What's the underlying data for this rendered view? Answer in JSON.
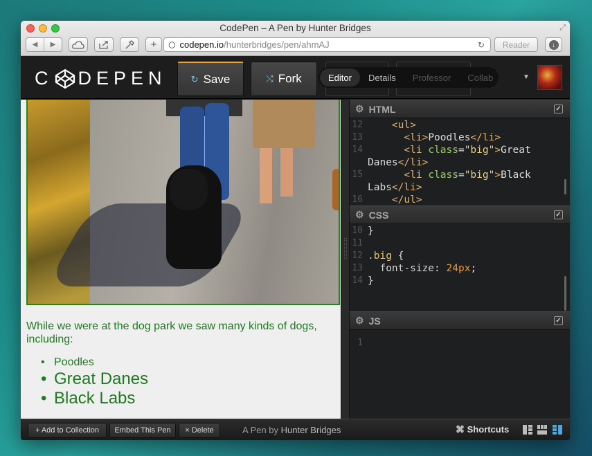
{
  "window": {
    "title": "CodePen – A Pen by Hunter Bridges"
  },
  "toolbar": {
    "url_host": "codepen.io",
    "url_path": "/hunterbridges/pen/ahmAJ",
    "reader_label": "Reader",
    "plus_label": "+"
  },
  "header": {
    "logo_text_left": "C",
    "logo_text_right": "DEPEN",
    "save_label": "Save",
    "fork_label": "Fork",
    "view_tabs": [
      "Editor",
      "Details",
      "Professor",
      "Collab"
    ],
    "active_view": "Editor"
  },
  "preview": {
    "intro": "While we were at the dog park we saw many kinds of dogs, including:",
    "items": [
      {
        "label": "Poodles",
        "size": "normal"
      },
      {
        "label": "Great Danes",
        "size": "big"
      },
      {
        "label": "Black Labs",
        "size": "big"
      }
    ]
  },
  "editors": {
    "html": {
      "title": "HTML",
      "lines": [
        {
          "n": "12",
          "indent": "    ",
          "parts": [
            [
              "tag",
              "<ul>"
            ]
          ]
        },
        {
          "n": "13",
          "indent": "      ",
          "parts": [
            [
              "tag",
              "<li>"
            ],
            [
              "text",
              "Poodles"
            ],
            [
              "tag",
              "</li>"
            ]
          ]
        },
        {
          "n": "14",
          "indent": "      ",
          "parts": [
            [
              "tag",
              "<li "
            ],
            [
              "attr",
              "class"
            ],
            [
              "text",
              "="
            ],
            [
              "str",
              "\"big\""
            ],
            [
              "tag",
              ">"
            ],
            [
              "text",
              "Great"
            ]
          ]
        },
        {
          "n": "",
          "indent": "",
          "parts": [
            [
              "text",
              "Danes"
            ],
            [
              "tag",
              "</li>"
            ]
          ]
        },
        {
          "n": "15",
          "indent": "      ",
          "parts": [
            [
              "tag",
              "<li "
            ],
            [
              "attr",
              "class"
            ],
            [
              "text",
              "="
            ],
            [
              "str",
              "\"big\""
            ],
            [
              "tag",
              ">"
            ],
            [
              "text",
              "Black"
            ]
          ]
        },
        {
          "n": "",
          "indent": "",
          "parts": [
            [
              "text",
              "Labs"
            ],
            [
              "tag",
              "</li>"
            ]
          ]
        },
        {
          "n": "16",
          "indent": "    ",
          "parts": [
            [
              "tag",
              "</ul>"
            ]
          ]
        }
      ]
    },
    "css": {
      "title": "CSS",
      "lines": [
        {
          "n": "10",
          "indent": "",
          "parts": [
            [
              "text",
              "}"
            ]
          ]
        },
        {
          "n": "11",
          "indent": "",
          "parts": []
        },
        {
          "n": "12",
          "indent": "",
          "parts": [
            [
              "sel",
              ".big"
            ],
            [
              "text",
              " {"
            ]
          ]
        },
        {
          "n": "13",
          "indent": "  ",
          "parts": [
            [
              "prop",
              "font-size"
            ],
            [
              "text",
              ": "
            ],
            [
              "num",
              "24px"
            ],
            [
              "text",
              ";"
            ]
          ]
        },
        {
          "n": "14",
          "indent": "",
          "parts": [
            [
              "text",
              "}"
            ]
          ]
        }
      ]
    },
    "js": {
      "title": "JS",
      "lines": [
        {
          "n": "1",
          "indent": "",
          "parts": []
        }
      ]
    }
  },
  "footer": {
    "add_collection": "+ Add to Collection",
    "embed": "Embed This Pen",
    "delete": "× Delete",
    "credit_prefix": "A Pen by",
    "credit_author": "Hunter Bridges",
    "shortcuts": "⌘ Shortcuts"
  },
  "colors": {
    "accent_save": "#f1a42b",
    "preview_text": "#1e7a1e",
    "layout_active": "#4aa8e0"
  },
  "icons": [
    "back-icon",
    "forward-icon",
    "cloud-icon",
    "share-icon",
    "tools-icon",
    "site-icon",
    "reload-icon",
    "download-icon",
    "gear-icon",
    "checkbox-icon",
    "layout-icon"
  ]
}
